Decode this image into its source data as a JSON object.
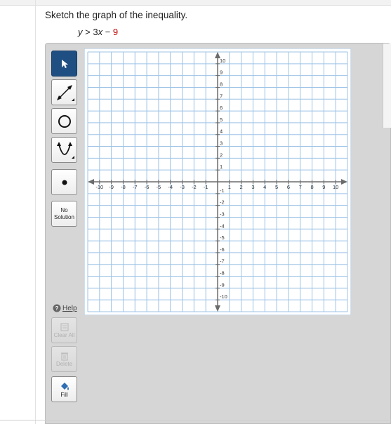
{
  "problem": {
    "prompt": "Sketch the graph of the inequality.",
    "inequality": {
      "lhs": "y",
      "op": " > ",
      "coef": "3",
      "var": "x",
      "minus": " − ",
      "const": "9"
    }
  },
  "toolbar": {
    "tools": [
      {
        "name": "pointer",
        "icon": "arrow-pointer-icon",
        "active": true
      },
      {
        "name": "line",
        "icon": "line-tool-icon"
      },
      {
        "name": "circle",
        "icon": "circle-tool-icon"
      },
      {
        "name": "parabola",
        "icon": "parabola-tool-icon"
      },
      {
        "name": "point",
        "icon": "point-tool-icon"
      }
    ],
    "no_solution_label": "No Solution",
    "help_label": "Help",
    "clear_all_label": "Clear All",
    "delete_label": "Delete",
    "fill_label": "Fill"
  },
  "graph": {
    "xmin": -10,
    "xmax": 10,
    "ymin": -10,
    "ymax": 10,
    "x_tick_labels": [
      "-10",
      "-9",
      "-8",
      "-7",
      "-6",
      "-5",
      "-4",
      "-3",
      "-2",
      "-1",
      "1",
      "2",
      "3",
      "4",
      "5",
      "6",
      "7",
      "8",
      "9",
      "10"
    ],
    "y_tick_labels": [
      "10",
      "9",
      "8",
      "7",
      "6",
      "5",
      "4",
      "3",
      "2",
      "1",
      "-1",
      "-2",
      "-3",
      "-4",
      "-5",
      "-6",
      "-7",
      "-8",
      "-9",
      "-10"
    ],
    "grid": true,
    "grid_color": "#9dc3e6",
    "axis_color": "#6b6b6b"
  }
}
